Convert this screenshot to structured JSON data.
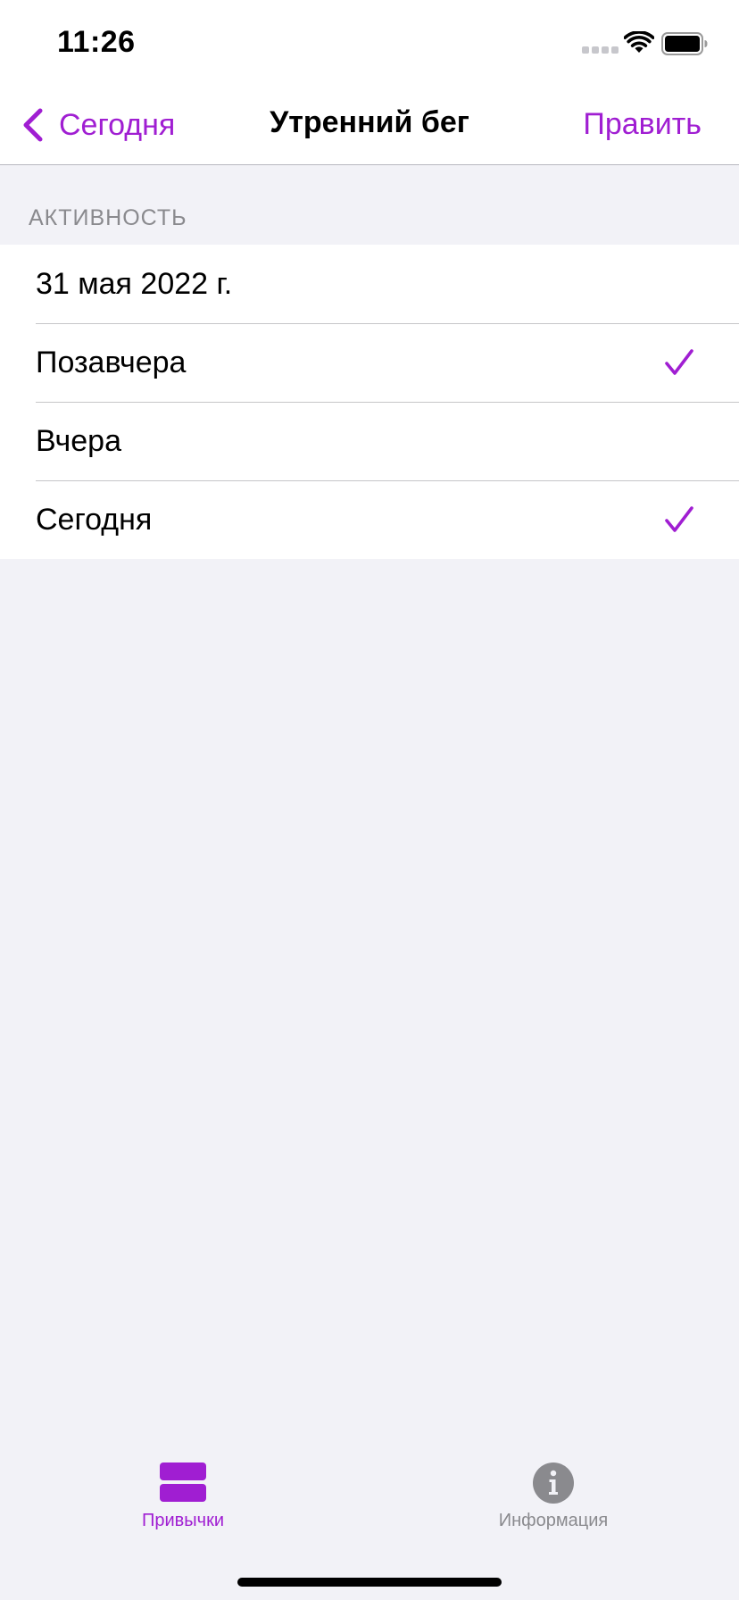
{
  "status_bar": {
    "time": "11:26"
  },
  "nav": {
    "back_label": "Сегодня",
    "title": "Утренний бег",
    "edit_label": "Править"
  },
  "section": {
    "header": "АКТИВНОСТЬ"
  },
  "list": {
    "items": [
      {
        "label": "31 мая 2022 г.",
        "checked": false
      },
      {
        "label": "Позавчера",
        "checked": true
      },
      {
        "label": "Вчера",
        "checked": false
      },
      {
        "label": "Сегодня",
        "checked": true
      }
    ]
  },
  "tab_bar": {
    "tabs": [
      {
        "label": "Привычки",
        "icon": "habits-icon",
        "active": true
      },
      {
        "label": "Информация",
        "icon": "info-icon",
        "active": false
      }
    ]
  },
  "colors": {
    "accent": "#a01ed2",
    "inactive": "#8a8a8e",
    "background": "#f2f2f7"
  }
}
